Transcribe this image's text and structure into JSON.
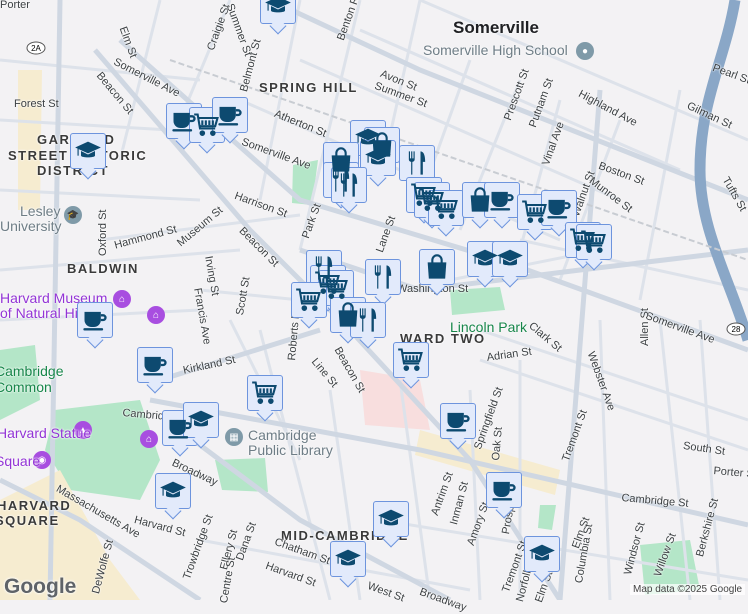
{
  "map": {
    "labels": [
      {
        "text": "Somerville",
        "kind": "city"
      },
      {
        "text": "Somerville High School",
        "kind": "poi"
      },
      {
        "text": "SPRING HILL",
        "kind": "area"
      },
      {
        "text": "GARFIELD",
        "kind": "area"
      },
      {
        "text": "STREET HISTORIC",
        "kind": "area"
      },
      {
        "text": "DISTRICT",
        "kind": "area"
      },
      {
        "text": "BALDWIN",
        "kind": "area"
      },
      {
        "text": "WARD TWO",
        "kind": "area"
      },
      {
        "text": "MID-CAMBRIDGE",
        "kind": "area"
      },
      {
        "text": "HARVARD",
        "kind": "area"
      },
      {
        "text": "SQUARE",
        "kind": "area"
      },
      {
        "text": "Lesley",
        "kind": "poi"
      },
      {
        "text": "University",
        "kind": "poi"
      },
      {
        "text": "Harvard Museum",
        "kind": "museum"
      },
      {
        "text": "of Natural History",
        "kind": "museum"
      },
      {
        "text": "Harvard Statue",
        "kind": "museum"
      },
      {
        "text": "Square",
        "kind": "museum"
      },
      {
        "text": "Cambridge",
        "kind": "park"
      },
      {
        "text": "Common",
        "kind": "park"
      },
      {
        "text": "Lincoln Park",
        "kind": "park"
      },
      {
        "text": "Cambridge",
        "kind": "poi"
      },
      {
        "text": "Public Library",
        "kind": "poi"
      },
      {
        "text": "Porter",
        "kind": "street"
      },
      {
        "text": "Elm St",
        "kind": "street"
      },
      {
        "text": "Somerville Ave",
        "kind": "street"
      },
      {
        "text": "Beacon St",
        "kind": "street"
      },
      {
        "text": "Forest St",
        "kind": "street"
      },
      {
        "text": "Craigie St",
        "kind": "street"
      },
      {
        "text": "Belmont St",
        "kind": "street"
      },
      {
        "text": "Summer St",
        "kind": "street"
      },
      {
        "text": "Benton Rd",
        "kind": "street"
      },
      {
        "text": "Atherton St",
        "kind": "street"
      },
      {
        "text": "Somerville Ave",
        "kind": "street"
      },
      {
        "text": "Harrison St",
        "kind": "street"
      },
      {
        "text": "Park St",
        "kind": "street"
      },
      {
        "text": "Beacon St",
        "kind": "street"
      },
      {
        "text": "Museum St",
        "kind": "street"
      },
      {
        "text": "Hammond St",
        "kind": "street"
      },
      {
        "text": "Oxford St",
        "kind": "street"
      },
      {
        "text": "Irving St",
        "kind": "street"
      },
      {
        "text": "Francis Ave",
        "kind": "street"
      },
      {
        "text": "Scott St",
        "kind": "street"
      },
      {
        "text": "Kirkland St",
        "kind": "street"
      },
      {
        "text": "Line St",
        "kind": "street"
      },
      {
        "text": "Beacon St",
        "kind": "street"
      },
      {
        "text": "Cambridge St",
        "kind": "street"
      },
      {
        "text": "Broadway",
        "kind": "street"
      },
      {
        "text": "Massachusetts Ave",
        "kind": "street"
      },
      {
        "text": "Harvard St",
        "kind": "street"
      },
      {
        "text": "Trowbridge St",
        "kind": "street"
      },
      {
        "text": "Dana St",
        "kind": "street"
      },
      {
        "text": "Ellery St",
        "kind": "street"
      },
      {
        "text": "Chatham St",
        "kind": "street"
      },
      {
        "text": "Harvard St",
        "kind": "street"
      },
      {
        "text": "DeWolfe St",
        "kind": "street"
      },
      {
        "text": "Avon St",
        "kind": "street"
      },
      {
        "text": "Summer St",
        "kind": "street"
      },
      {
        "text": "Prescott St",
        "kind": "street"
      },
      {
        "text": "Putnam St",
        "kind": "street"
      },
      {
        "text": "Vinal Ave",
        "kind": "street"
      },
      {
        "text": "Highland Ave",
        "kind": "street"
      },
      {
        "text": "Walnut St",
        "kind": "street"
      },
      {
        "text": "Boston St",
        "kind": "street"
      },
      {
        "text": "Munroe St",
        "kind": "street"
      },
      {
        "text": "Pearl St",
        "kind": "street"
      },
      {
        "text": "Gilman St",
        "kind": "street"
      },
      {
        "text": "Tufts St",
        "kind": "street"
      },
      {
        "text": "Lane St",
        "kind": "street"
      },
      {
        "text": "Washington St",
        "kind": "street"
      },
      {
        "text": "Clark St",
        "kind": "street"
      },
      {
        "text": "Adrian St",
        "kind": "street"
      },
      {
        "text": "Somerville Ave",
        "kind": "street"
      },
      {
        "text": "Allen St",
        "kind": "street"
      },
      {
        "text": "Webster Ave",
        "kind": "street"
      },
      {
        "text": "Springfield St",
        "kind": "street"
      },
      {
        "text": "Oak St",
        "kind": "street"
      },
      {
        "text": "Tremont St",
        "kind": "street"
      },
      {
        "text": "South St",
        "kind": "street"
      },
      {
        "text": "Porter St",
        "kind": "street"
      },
      {
        "text": "Cambridge St",
        "kind": "street"
      },
      {
        "text": "Antrim St",
        "kind": "street"
      },
      {
        "text": "Inman St",
        "kind": "street"
      },
      {
        "text": "Amory St",
        "kind": "street"
      },
      {
        "text": "Prospect St",
        "kind": "street"
      },
      {
        "text": "Elm St",
        "kind": "street"
      },
      {
        "text": "Columbia St",
        "kind": "street"
      },
      {
        "text": "Windsor St",
        "kind": "street"
      },
      {
        "text": "Willow St",
        "kind": "street"
      },
      {
        "text": "Berkshire St",
        "kind": "street"
      },
      {
        "text": "Tremont St",
        "kind": "street"
      },
      {
        "text": "Norfolk St",
        "kind": "street"
      },
      {
        "text": "Elm St",
        "kind": "street"
      },
      {
        "text": "Broadway",
        "kind": "street"
      },
      {
        "text": "West St",
        "kind": "street"
      },
      {
        "text": "Centre St",
        "kind": "street"
      },
      {
        "text": "Roberts Rd",
        "kind": "street"
      },
      {
        "text": "Map data ©2025 Google",
        "kind": "attr"
      },
      {
        "text": "Google",
        "kind": "logo"
      }
    ],
    "route_shields": [
      "2A",
      "28"
    ],
    "markers": [
      "graduation-cap",
      "cup",
      "cart",
      "cup",
      "graduation-cap",
      "graduation-cap",
      "bag",
      "bag",
      "graduation-cap",
      "utensils",
      "utensils",
      "utensils",
      "cart",
      "cart",
      "cart",
      "bag",
      "cup",
      "cart",
      "cup",
      "cart",
      "cart",
      "graduation-cap",
      "graduation-cap",
      "bag",
      "utensils",
      "utensils",
      "cart",
      "cart",
      "cart",
      "bag",
      "utensils",
      "cart",
      "cup",
      "cup",
      "cart",
      "cup",
      "graduation-cap",
      "cup",
      "cup",
      "graduation-cap",
      "graduation-cap",
      "graduation-cap",
      "graduation-cap"
    ],
    "colors": {
      "marker_bg": "#e2eafb",
      "marker_border": "#6d94dd",
      "icon": "#0d4a70",
      "park": "#a9e3c0",
      "river": "#8aa7c7",
      "road": "#d6dde6"
    }
  }
}
